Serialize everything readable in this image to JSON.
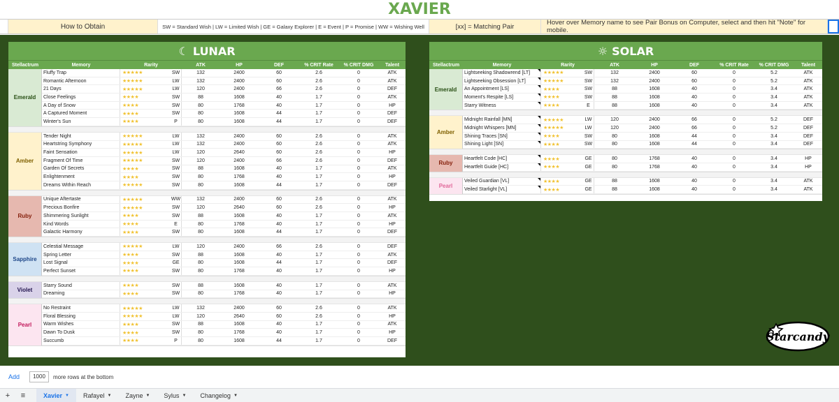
{
  "page_title": "XAVIER",
  "legend": {
    "how_to_obtain": "How to Obtain",
    "sources": "SW = Standard Wish | LW = Limited Wish | GE = Galaxy Explorer | E = Event | P = Promise | WW = Wishing Well",
    "matching_pair": "[xx] = Matching Pair",
    "hover_note": "Hover over Memory name to see Pair Bonus on Computer, select and then hit \"Note\" for mobile."
  },
  "columns": [
    "Stellactrum",
    "Memory",
    "Rarity",
    "ATK",
    "HP",
    "DEF",
    "% CRIT Rate",
    "% CRIT DMG",
    "Talent"
  ],
  "lunar": {
    "title": "LUNAR",
    "groups": [
      {
        "name": "Emerald",
        "color": "#d9ead3",
        "text": "#274e13",
        "rows": [
          {
            "memory": "Fluffy Trap",
            "stars": "★★★★★",
            "src": "SW",
            "atk": "132",
            "hp": "2400",
            "def": "60",
            "cr": "2.6",
            "cd": "0",
            "talent": "ATK"
          },
          {
            "memory": "Romantic Afternoon",
            "stars": "★★★★★",
            "src": "LW",
            "atk": "132",
            "hp": "2400",
            "def": "60",
            "cr": "2.6",
            "cd": "0",
            "talent": "ATK"
          },
          {
            "memory": "21 Days",
            "stars": "★★★★★",
            "src": "LW",
            "atk": "120",
            "hp": "2400",
            "def": "66",
            "cr": "2.6",
            "cd": "0",
            "talent": "DEF"
          },
          {
            "memory": "Close Feelings",
            "stars": "★★★★",
            "src": "SW",
            "atk": "88",
            "hp": "1608",
            "def": "40",
            "cr": "1.7",
            "cd": "0",
            "talent": "ATK"
          },
          {
            "memory": "A Day of Snow",
            "stars": "★★★★",
            "src": "SW",
            "atk": "80",
            "hp": "1768",
            "def": "40",
            "cr": "1.7",
            "cd": "0",
            "talent": "HP"
          },
          {
            "memory": "A Captured Moment",
            "stars": "★★★★",
            "src": "SW",
            "atk": "80",
            "hp": "1608",
            "def": "44",
            "cr": "1.7",
            "cd": "0",
            "talent": "DEF"
          },
          {
            "memory": "Winter's Sun",
            "stars": "★★★★",
            "src": "P",
            "atk": "80",
            "hp": "1608",
            "def": "44",
            "cr": "1.7",
            "cd": "0",
            "talent": "DEF"
          }
        ]
      },
      {
        "name": "Amber",
        "color": "#fff2cc",
        "text": "#7f6000",
        "rows": [
          {
            "memory": "Tender Night",
            "stars": "★★★★★",
            "src": "LW",
            "atk": "132",
            "hp": "2400",
            "def": "60",
            "cr": "2.6",
            "cd": "0",
            "talent": "ATK"
          },
          {
            "memory": "Heartstring Symphony",
            "stars": "★★★★★",
            "src": "LW",
            "atk": "132",
            "hp": "2400",
            "def": "60",
            "cr": "2.6",
            "cd": "0",
            "talent": "ATK"
          },
          {
            "memory": "Faint Sensation",
            "stars": "★★★★★",
            "src": "LW",
            "atk": "120",
            "hp": "2640",
            "def": "60",
            "cr": "2.6",
            "cd": "0",
            "talent": "HP"
          },
          {
            "memory": "Fragment Of Time",
            "stars": "★★★★★",
            "src": "SW",
            "atk": "120",
            "hp": "2400",
            "def": "66",
            "cr": "2.6",
            "cd": "0",
            "talent": "DEF"
          },
          {
            "memory": "Garden Of Secrets",
            "stars": "★★★★",
            "src": "SW",
            "atk": "88",
            "hp": "1608",
            "def": "40",
            "cr": "1.7",
            "cd": "0",
            "talent": "ATK"
          },
          {
            "memory": "Enlightenment",
            "stars": "★★★★",
            "src": "SW",
            "atk": "80",
            "hp": "1768",
            "def": "40",
            "cr": "1.7",
            "cd": "0",
            "talent": "HP"
          },
          {
            "memory": "Dreams Within Reach",
            "stars": "★★★★★",
            "src": "SW",
            "atk": "80",
            "hp": "1608",
            "def": "44",
            "cr": "1.7",
            "cd": "0",
            "talent": "DEF"
          }
        ]
      },
      {
        "name": "Ruby",
        "color": "#e6b8af",
        "text": "#85200c",
        "rows": [
          {
            "memory": "Unique Aftertaste",
            "stars": "★★★★★",
            "src": "WW",
            "atk": "132",
            "hp": "2400",
            "def": "60",
            "cr": "2.6",
            "cd": "0",
            "talent": "ATK"
          },
          {
            "memory": "Precious Bonfire",
            "stars": "★★★★★",
            "src": "SW",
            "atk": "120",
            "hp": "2640",
            "def": "60",
            "cr": "2.6",
            "cd": "0",
            "talent": "HP"
          },
          {
            "memory": "Shimmering Sunlight",
            "stars": "★★★★",
            "src": "SW",
            "atk": "88",
            "hp": "1608",
            "def": "40",
            "cr": "1.7",
            "cd": "0",
            "talent": "ATK"
          },
          {
            "memory": "Kind Words",
            "stars": "★★★★",
            "src": "E",
            "atk": "80",
            "hp": "1768",
            "def": "40",
            "cr": "1.7",
            "cd": "0",
            "talent": "HP"
          },
          {
            "memory": "Galactic Harmony",
            "stars": "★★★★",
            "src": "SW",
            "atk": "80",
            "hp": "1608",
            "def": "44",
            "cr": "1.7",
            "cd": "0",
            "talent": "DEF"
          }
        ]
      },
      {
        "name": "Sapphire",
        "color": "#cfe2f3",
        "text": "#1c4587",
        "rows": [
          {
            "memory": "Celestial Message",
            "stars": "★★★★★",
            "src": "LW",
            "atk": "120",
            "hp": "2400",
            "def": "66",
            "cr": "2.6",
            "cd": "0",
            "talent": "DEF"
          },
          {
            "memory": "Spring Letter",
            "stars": "★★★★",
            "src": "SW",
            "atk": "88",
            "hp": "1608",
            "def": "40",
            "cr": "1.7",
            "cd": "0",
            "talent": "ATK"
          },
          {
            "memory": "Lost Signal",
            "stars": "★★★★",
            "src": "GE",
            "atk": "80",
            "hp": "1608",
            "def": "44",
            "cr": "1.7",
            "cd": "0",
            "talent": "DEF"
          },
          {
            "memory": "Perfect Sunset",
            "stars": "★★★★",
            "src": "SW",
            "atk": "80",
            "hp": "1768",
            "def": "40",
            "cr": "1.7",
            "cd": "0",
            "talent": "HP"
          }
        ]
      },
      {
        "name": "Violet",
        "color": "#d9d2e9",
        "text": "#20124d",
        "rows": [
          {
            "memory": "Starry Sound",
            "stars": "★★★★",
            "src": "SW",
            "atk": "88",
            "hp": "1608",
            "def": "40",
            "cr": "1.7",
            "cd": "0",
            "talent": "ATK"
          },
          {
            "memory": "Dreaming",
            "stars": "★★★★",
            "src": "SW",
            "atk": "80",
            "hp": "1768",
            "def": "40",
            "cr": "1.7",
            "cd": "0",
            "talent": "HP"
          }
        ]
      },
      {
        "name": "Pearl",
        "color": "#fce5f0",
        "text": "#c2185b",
        "rows": [
          {
            "memory": "No Restraint",
            "stars": "★★★★★",
            "src": "LW",
            "atk": "132",
            "hp": "2400",
            "def": "60",
            "cr": "2.6",
            "cd": "0",
            "talent": "ATK"
          },
          {
            "memory": "Floral Blessing",
            "stars": "★★★★★",
            "src": "LW",
            "atk": "120",
            "hp": "2640",
            "def": "60",
            "cr": "2.6",
            "cd": "0",
            "talent": "HP"
          },
          {
            "memory": "Warm Wishes",
            "stars": "★★★★",
            "src": "SW",
            "atk": "88",
            "hp": "1608",
            "def": "40",
            "cr": "1.7",
            "cd": "0",
            "talent": "ATK"
          },
          {
            "memory": "Dawn To Dusk",
            "stars": "★★★★",
            "src": "SW",
            "atk": "80",
            "hp": "1768",
            "def": "40",
            "cr": "1.7",
            "cd": "0",
            "talent": "HP"
          },
          {
            "memory": "Succumb",
            "stars": "★★★★",
            "src": "P",
            "atk": "80",
            "hp": "1608",
            "def": "44",
            "cr": "1.7",
            "cd": "0",
            "talent": "DEF"
          }
        ]
      }
    ]
  },
  "solar": {
    "title": "SOLAR",
    "groups": [
      {
        "name": "Emerald",
        "color": "#d9ead3",
        "text": "#274e13",
        "rows": [
          {
            "memory": "Lightseeking Shadowrend [LT]",
            "stars": "★★★★★",
            "src": "SW",
            "atk": "132",
            "hp": "2400",
            "def": "60",
            "cr": "0",
            "cd": "5.2",
            "talent": "ATK"
          },
          {
            "memory": "Lightseeking Obsession [LT]",
            "stars": "★★★★★",
            "src": "SW",
            "atk": "132",
            "hp": "2400",
            "def": "60",
            "cr": "0",
            "cd": "5.2",
            "talent": "ATK"
          },
          {
            "memory": "An Appointment [LS]",
            "stars": "★★★★",
            "src": "SW",
            "atk": "88",
            "hp": "1608",
            "def": "40",
            "cr": "0",
            "cd": "3.4",
            "talent": "ATK"
          },
          {
            "memory": "Moment's Respite [LS]",
            "stars": "★★★★",
            "src": "SW",
            "atk": "88",
            "hp": "1608",
            "def": "40",
            "cr": "0",
            "cd": "3.4",
            "talent": "ATK"
          },
          {
            "memory": "Starry Witness",
            "stars": "★★★★",
            "src": "E",
            "atk": "88",
            "hp": "1608",
            "def": "40",
            "cr": "0",
            "cd": "3.4",
            "talent": "ATK"
          }
        ]
      },
      {
        "name": "Amber",
        "color": "#fff2cc",
        "text": "#7f6000",
        "rows": [
          {
            "memory": "Midnight Rainfall [MN]",
            "stars": "★★★★★",
            "src": "LW",
            "atk": "120",
            "hp": "2400",
            "def": "66",
            "cr": "0",
            "cd": "5.2",
            "talent": "DEF"
          },
          {
            "memory": "Midnight Whispers [MN]",
            "stars": "★★★★★",
            "src": "LW",
            "atk": "120",
            "hp": "2400",
            "def": "66",
            "cr": "0",
            "cd": "5.2",
            "talent": "DEF"
          },
          {
            "memory": "Shining Traces [SN]",
            "stars": "★★★★",
            "src": "SW",
            "atk": "80",
            "hp": "1608",
            "def": "44",
            "cr": "0",
            "cd": "3.4",
            "talent": "DEF"
          },
          {
            "memory": "Shining Light [SN]",
            "stars": "★★★★",
            "src": "SW",
            "atk": "80",
            "hp": "1608",
            "def": "44",
            "cr": "0",
            "cd": "3.4",
            "talent": "DEF"
          }
        ]
      },
      {
        "name": "Ruby",
        "color": "#e6b8af",
        "text": "#85200c",
        "rows": [
          {
            "memory": "Heartfelt Code [HC]",
            "stars": "★★★★",
            "src": "GE",
            "atk": "80",
            "hp": "1768",
            "def": "40",
            "cr": "0",
            "cd": "3.4",
            "talent": "HP"
          },
          {
            "memory": "Heartfelt Guide [HC]",
            "stars": "★★★★",
            "src": "GE",
            "atk": "80",
            "hp": "1768",
            "def": "40",
            "cr": "0",
            "cd": "3.4",
            "talent": "HP"
          }
        ]
      },
      {
        "name": "Pearl",
        "color": "#fce5f0",
        "text": "#e06698",
        "rows": [
          {
            "memory": "Veiled Guardian [VL]",
            "stars": "★★★★",
            "src": "GE",
            "atk": "88",
            "hp": "1608",
            "def": "40",
            "cr": "0",
            "cd": "3.4",
            "talent": "ATK"
          },
          {
            "memory": "Veiled Starlight [VL]",
            "stars": "★★★★",
            "src": "GE",
            "atk": "88",
            "hp": "1608",
            "def": "40",
            "cr": "0",
            "cd": "3.4",
            "talent": "ATK"
          }
        ]
      }
    ]
  },
  "bottom": {
    "add_label": "Add",
    "rows_value": "1000",
    "rows_suffix": "more rows at the bottom"
  },
  "tabs": [
    "Xavier",
    "Rafayel",
    "Zayne",
    "Sylus",
    "Changelog"
  ],
  "active_tab": "Xavier",
  "logo_text": "Starcandy"
}
